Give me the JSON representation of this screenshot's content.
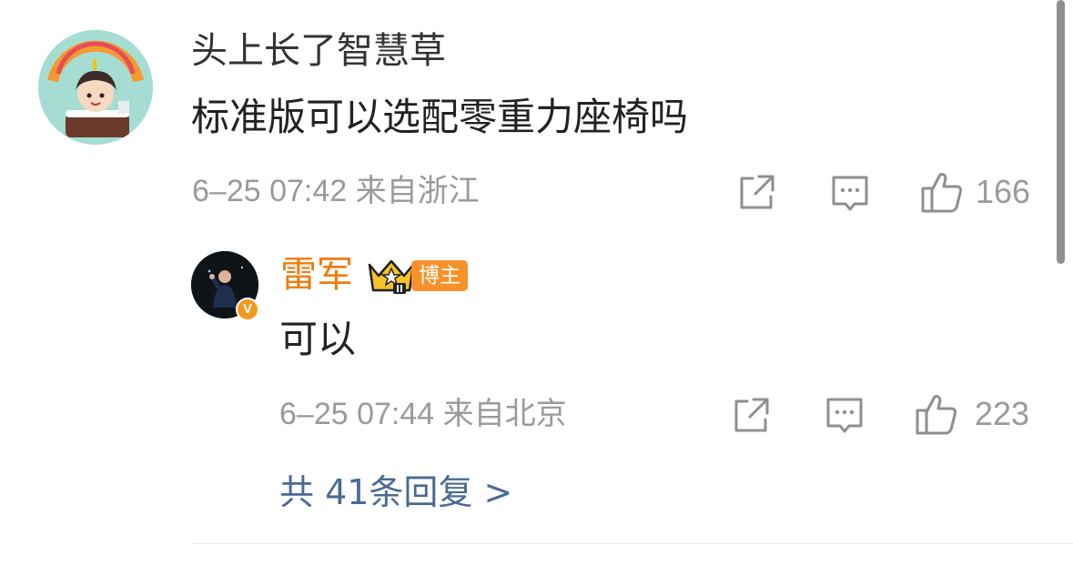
{
  "colors": {
    "meta_gray": "#9a9a9a",
    "username_orange": "#f07b0b",
    "link_blue": "#4a6a94",
    "badge_orange": "#f7922a"
  },
  "comment": {
    "username": "头上长了智慧草",
    "text": "标准版可以选配零重力座椅吗",
    "meta": "6–25 07:42 来自浙江",
    "avatar_icon": "birthday-avatar-icon",
    "share_icon": "share-icon",
    "reply_icon": "comment-icon",
    "like_icon": "thumbs-up-icon",
    "likes": "166"
  },
  "reply": {
    "username": "雷军",
    "badge_label": "博主",
    "text": "可以",
    "meta": "6–25 07:44 来自北京",
    "verified_badge": "V",
    "likes": "223",
    "avatar_icon": "profile-avatar-icon",
    "crown_icon": "crown-badge-icon"
  },
  "more_replies": "共 41条回复 >"
}
